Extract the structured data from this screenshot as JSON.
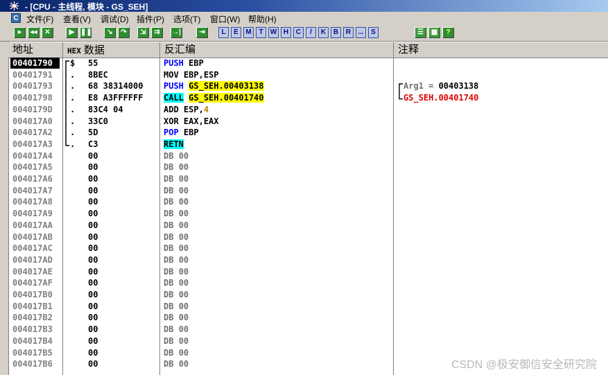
{
  "window": {
    "title": "- [CPU - 主线程, 模块 - GS_SEH]"
  },
  "menu": [
    "文件(F)",
    "查看(V)",
    "调试(D)",
    "插件(P)",
    "选项(T)",
    "窗口(W)",
    "帮助(H)"
  ],
  "toolbar": {
    "letters": [
      "L",
      "E",
      "M",
      "T",
      "W",
      "H",
      "C",
      "/",
      "K",
      "B",
      "R",
      "...",
      "S"
    ]
  },
  "columns": {
    "address": "地址",
    "hex_tag": "HEX",
    "hex_label": "数据",
    "disasm": "反汇编",
    "comment": "注释"
  },
  "rows": [
    {
      "addr": "00401790",
      "mark": "$",
      "hex": "55",
      "mnem": "PUSH",
      "ops": "EBP",
      "selected": true
    },
    {
      "addr": "00401791",
      "mark": ".",
      "hex": "8BEC",
      "mnem": "MOV",
      "ops": "EBP,ESP"
    },
    {
      "addr": "00401793",
      "mark": ".",
      "hex": "68 38314000",
      "mnem": "PUSH",
      "ops": "GS_SEH.00403138",
      "comment1": "Arg1 = 00403138"
    },
    {
      "addr": "00401798",
      "mark": ".",
      "hex": "E8 A3FFFFFF",
      "mnem": "CALL",
      "ops": "GS_SEH.00401740",
      "comment2": "GS_SEH.00401740"
    },
    {
      "addr": "0040179D",
      "mark": ".",
      "hex": "83C4 04",
      "mnem": "ADD",
      "ops": "ESP,4"
    },
    {
      "addr": "004017A0",
      "mark": ".",
      "hex": "33C0",
      "mnem": "XOR",
      "ops": "EAX,EAX"
    },
    {
      "addr": "004017A2",
      "mark": ".",
      "hex": "5D",
      "mnem": "POP",
      "ops": "EBP"
    },
    {
      "addr": "004017A3",
      "mark": ".",
      "hex": "C3",
      "mnem": "RETN",
      "ops": ""
    },
    {
      "addr": "004017A4",
      "hex": "00",
      "mnem": "DB",
      "ops": "00"
    },
    {
      "addr": "004017A5",
      "hex": "00",
      "mnem": "DB",
      "ops": "00"
    },
    {
      "addr": "004017A6",
      "hex": "00",
      "mnem": "DB",
      "ops": "00"
    },
    {
      "addr": "004017A7",
      "hex": "00",
      "mnem": "DB",
      "ops": "00"
    },
    {
      "addr": "004017A8",
      "hex": "00",
      "mnem": "DB",
      "ops": "00"
    },
    {
      "addr": "004017A9",
      "hex": "00",
      "mnem": "DB",
      "ops": "00"
    },
    {
      "addr": "004017AA",
      "hex": "00",
      "mnem": "DB",
      "ops": "00"
    },
    {
      "addr": "004017AB",
      "hex": "00",
      "mnem": "DB",
      "ops": "00"
    },
    {
      "addr": "004017AC",
      "hex": "00",
      "mnem": "DB",
      "ops": "00"
    },
    {
      "addr": "004017AD",
      "hex": "00",
      "mnem": "DB",
      "ops": "00"
    },
    {
      "addr": "004017AE",
      "hex": "00",
      "mnem": "DB",
      "ops": "00"
    },
    {
      "addr": "004017AF",
      "hex": "00",
      "mnem": "DB",
      "ops": "00"
    },
    {
      "addr": "004017B0",
      "hex": "00",
      "mnem": "DB",
      "ops": "00"
    },
    {
      "addr": "004017B1",
      "hex": "00",
      "mnem": "DB",
      "ops": "00"
    },
    {
      "addr": "004017B2",
      "hex": "00",
      "mnem": "DB",
      "ops": "00"
    },
    {
      "addr": "004017B3",
      "hex": "00",
      "mnem": "DB",
      "ops": "00"
    },
    {
      "addr": "004017B4",
      "hex": "00",
      "mnem": "DB",
      "ops": "00"
    },
    {
      "addr": "004017B5",
      "hex": "00",
      "mnem": "DB",
      "ops": "00"
    },
    {
      "addr": "004017B6",
      "hex": "00",
      "mnem": "DB",
      "ops": "00"
    }
  ],
  "watermark": "CSDN @极安御信安全研究院",
  "colors": {
    "title_bar": "#0a246a",
    "keyword_blue": "#0000ff",
    "keyword_red": "#e00000",
    "highlight_yellow": "#ffff00",
    "highlight_cyan": "#00ffff",
    "selection": "#000000"
  }
}
